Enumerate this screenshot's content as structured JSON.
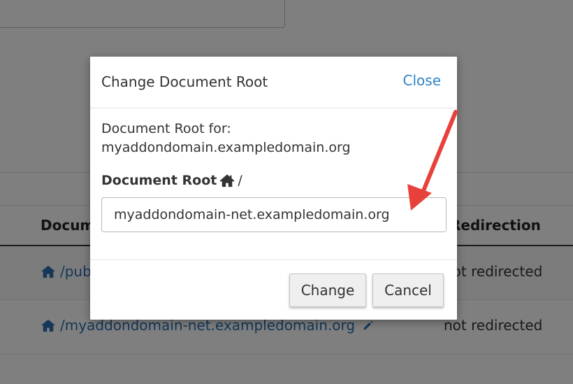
{
  "background": {
    "table": {
      "headers": {
        "document_root": "Docum",
        "redirection": "Redirection"
      },
      "rows": [
        {
          "path": "/pub",
          "redirection": "not redirected"
        },
        {
          "path": "/myaddondomain-net.exampledomain.org",
          "redirection": "not redirected"
        }
      ]
    }
  },
  "modal": {
    "title": "Change Document Root",
    "close_label": "Close",
    "document_root_for_label": "Document Root for:",
    "domain": "myaddondomain.exampledomain.org",
    "field_label": "Document Root",
    "field_suffix": "/",
    "field_value": "myaddondomain-net.exampledomain.org",
    "change_label": "Change",
    "cancel_label": "Cancel"
  },
  "colors": {
    "link": "#2a6fb0",
    "close_link": "#2d83c7",
    "annotation_arrow": "#e8413b",
    "overlay": "rgba(0,0,0,0.5)"
  },
  "icons": [
    "home-icon",
    "pencil-icon",
    "arrow-annotation"
  ]
}
